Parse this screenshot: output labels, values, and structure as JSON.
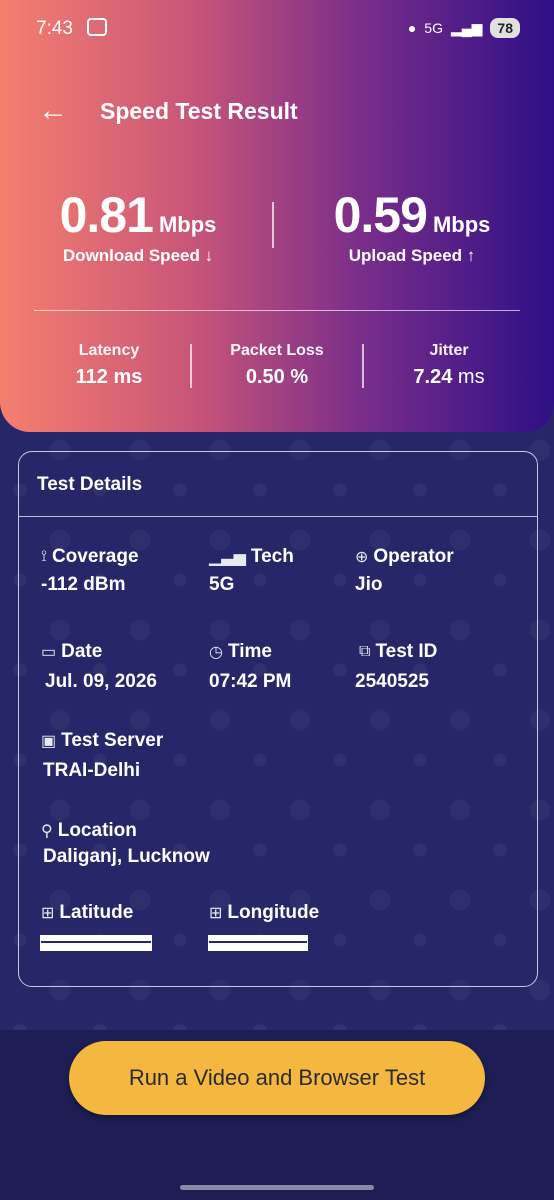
{
  "status_bar": {
    "time": "7:43",
    "network": "5G",
    "battery": "78"
  },
  "header": {
    "title": "Speed Test Result"
  },
  "download": {
    "value": "0.81",
    "unit": "Mbps",
    "label": "Download Speed ↓"
  },
  "upload": {
    "value": "0.59",
    "unit": "Mbps",
    "label": "Upload Speed ↑"
  },
  "metrics": [
    {
      "label": "Latency",
      "value": "112 ms"
    },
    {
      "label": "Packet Loss",
      "value": "0.50 %"
    },
    {
      "label": "Jitter",
      "value": "7.24",
      "unit": "ms"
    }
  ],
  "details": {
    "title": "Test Details",
    "coverage": {
      "label": "Coverage",
      "value": "-112 dBm"
    },
    "tech": {
      "label": "Tech",
      "value": "5G"
    },
    "operator": {
      "label": "Operator",
      "value": "Jio"
    },
    "date": {
      "label": "Date",
      "value": "Jul. 09, 2026"
    },
    "time": {
      "label": "Time",
      "value": "07:42 PM"
    },
    "test_id": {
      "label": "Test ID",
      "value": "2540525"
    },
    "server": {
      "label": "Test Server",
      "value": "TRAI-Delhi"
    },
    "location": {
      "label": "Location",
      "value": "Daliganj, Lucknow"
    },
    "latitude": {
      "label": "Latitude"
    },
    "longitude": {
      "label": "Longitude"
    }
  },
  "cta": {
    "label": "Run a Video and Browser Test"
  },
  "colors": {
    "accent": "#f4b840",
    "background": "#232356"
  }
}
